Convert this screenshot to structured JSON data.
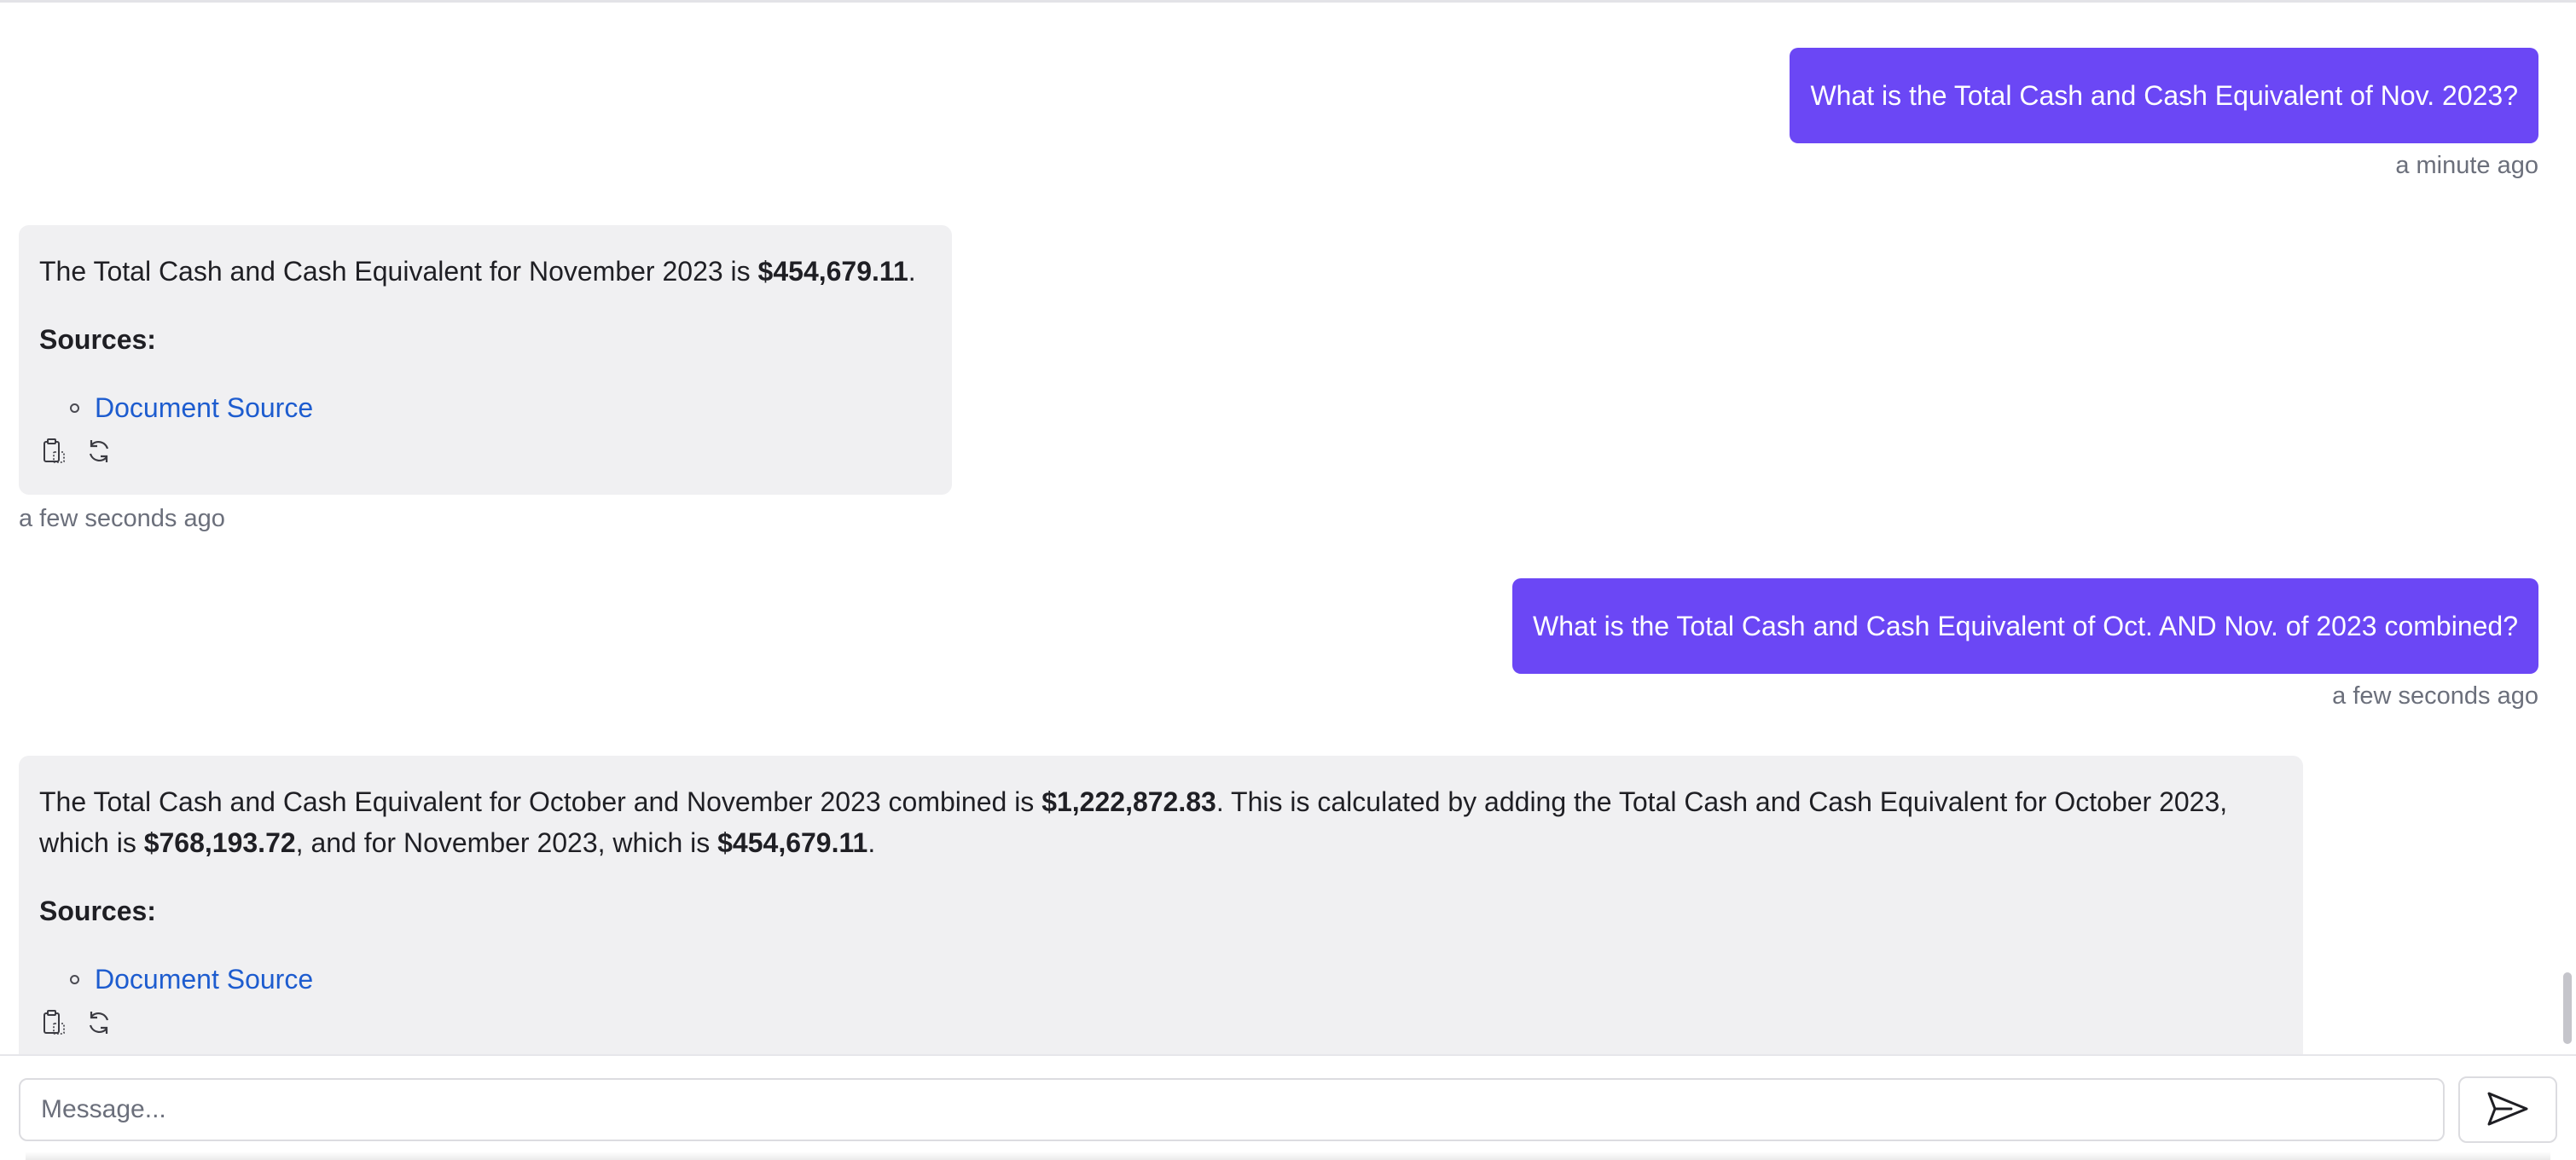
{
  "messages": [
    {
      "role": "user",
      "text": "What is the Total Cash and Cash Equivalent of Nov. 2023?",
      "timestamp": "a minute ago"
    },
    {
      "role": "assistant",
      "answer_parts": {
        "before": "The Total Cash and Cash Equivalent for November 2023 is ",
        "amount": "$454,679.11",
        "after": "."
      },
      "sources_label": "Sources:",
      "source_link": "Document Source",
      "timestamp": "a few seconds ago"
    },
    {
      "role": "user",
      "text": "What is the Total Cash and Cash Equivalent of Oct. AND Nov. of 2023 combined?",
      "timestamp": "a few seconds ago"
    },
    {
      "role": "assistant",
      "answer_parts": {
        "p1": "The Total Cash and Cash Equivalent for October and November 2023 combined is ",
        "amount1": "$1,222,872.83",
        "p2": ". This is calculated by adding the Total Cash and Cash Equivalent for October 2023, which is ",
        "amount2": "$768,193.72",
        "p3": ", and for November 2023, which is ",
        "amount3": "$454,679.11",
        "p4": "."
      },
      "sources_label": "Sources:",
      "source_link": "Document Source"
    }
  ],
  "icons": {
    "copy": "clipboard-copy-icon",
    "regenerate": "refresh-icon",
    "send": "send-icon"
  },
  "composer": {
    "placeholder": "Message..."
  },
  "colors": {
    "user_bubble": "#6b47f5",
    "assistant_bubble": "#f0f0f2",
    "link": "#1d5ccf",
    "timestamp": "#6b6f7b"
  }
}
